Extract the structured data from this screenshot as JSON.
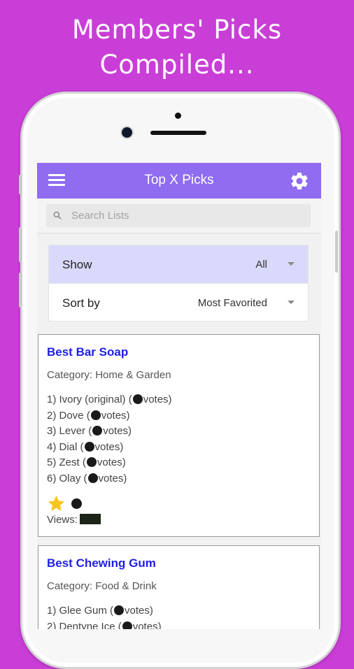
{
  "promo": {
    "line1": "Members' Picks",
    "line2": "Compiled..."
  },
  "appbar": {
    "title": "Top X Picks",
    "menu_icon": "hamburger-menu-icon",
    "settings_icon": "gear-icon"
  },
  "search": {
    "placeholder": "Search Lists"
  },
  "filters": {
    "show": {
      "label": "Show",
      "value": "All"
    },
    "sort": {
      "label": "Sort by",
      "value": "Most Favorited"
    }
  },
  "lists": [
    {
      "title": "Best Bar Soap",
      "category": "Category: Home & Garden",
      "items": [
        {
          "prefix": "1) Ivory (original) (",
          "suffix": "votes)"
        },
        {
          "prefix": "2) Dove (",
          "suffix": "votes)"
        },
        {
          "prefix": "3) Lever (",
          "suffix": "votes)"
        },
        {
          "prefix": "4) Dial (",
          "suffix": "votes)"
        },
        {
          "prefix": "5) Zest (",
          "suffix": "votes)"
        },
        {
          "prefix": "6) Olay (",
          "suffix": "votes)"
        }
      ],
      "views_label": "Views:"
    },
    {
      "title": "Best Chewing Gum",
      "category": "Category: Food & Drink",
      "items": [
        {
          "prefix": "1) Glee Gum (",
          "suffix": "votes)"
        },
        {
          "prefix": "2) Dentyne Ice (",
          "suffix": "votes)"
        }
      ]
    }
  ],
  "colors": {
    "background": "#c93ed6",
    "appbar": "#8f6cf0",
    "title_link": "#1f1fe6",
    "show_row": "#d9d9fb",
    "star": "#f7c51e"
  }
}
